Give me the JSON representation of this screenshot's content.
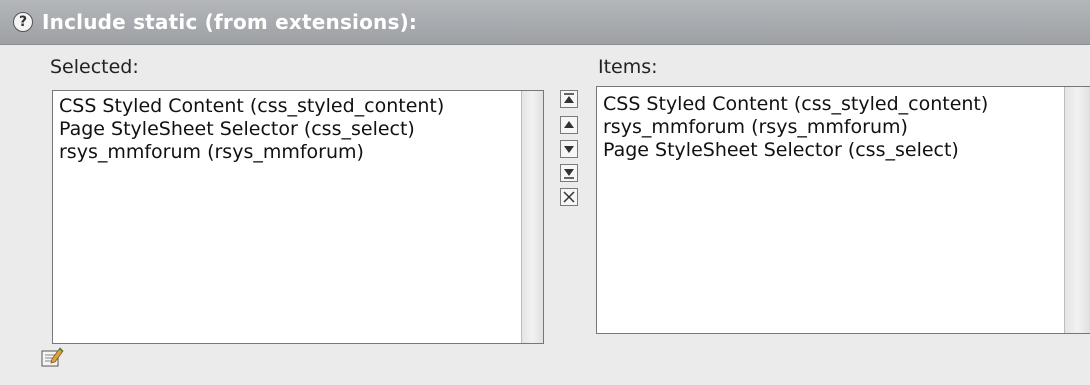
{
  "header": {
    "help_icon": "?",
    "title": "Include static (from extensions):"
  },
  "selected": {
    "label": "Selected:",
    "items": [
      "CSS Styled Content (css_styled_content)",
      "Page StyleSheet Selector (css_select)",
      "rsys_mmforum (rsys_mmforum)"
    ]
  },
  "available": {
    "label": "Items:",
    "items": [
      "CSS Styled Content (css_styled_content)",
      "rsys_mmforum (rsys_mmforum)",
      "Page StyleSheet Selector (css_select)"
    ]
  },
  "controls": [
    "move-to-top-icon",
    "move-up-icon",
    "move-down-icon",
    "move-to-bottom-icon",
    "remove-icon"
  ],
  "edit_icon": "edit-template-icon"
}
